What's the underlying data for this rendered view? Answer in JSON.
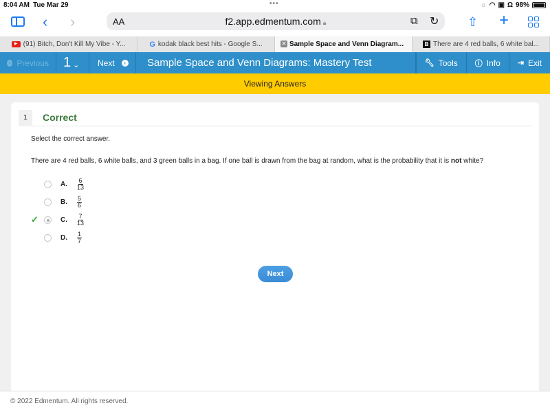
{
  "status_bar": {
    "time": "8:04 AM",
    "date": "Tue Mar 29",
    "battery": "98%",
    "battery_level": 0.98
  },
  "browser": {
    "text_size_label": "AA",
    "url": "f2.app.edmentum.com",
    "tabs": [
      {
        "favicon": "youtube-icon",
        "title": "(91) Bitch, Don't Kill My Vibe - Y...",
        "active": false
      },
      {
        "favicon": "google-icon",
        "title": "kodak black best hits - Google S...",
        "active": false
      },
      {
        "favicon": "edmentum-icon",
        "title": "Sample Space and Venn Diagram...",
        "active": true
      },
      {
        "favicon": "brainly-icon",
        "title": "There are 4 red balls, 6 white bal...",
        "active": false
      }
    ]
  },
  "nav": {
    "previous_label": "Previous",
    "question_number": "1",
    "next_label": "Next",
    "title": "Sample Space and Venn Diagrams: Mastery Test",
    "tools_label": "Tools",
    "info_label": "Info",
    "exit_label": "Exit",
    "accent_color": "#2e8fca"
  },
  "banner": {
    "text": "Viewing Answers",
    "color": "#ffcc00"
  },
  "question": {
    "number": "1",
    "status": "Correct",
    "instruction": "Select the correct answer.",
    "text_before": "There are 4 red balls, 6 white balls, and 3 green balls in a bag. If one ball is drawn from the bag at random, what is the probability that it is ",
    "text_bold": "not",
    "text_after": " white?",
    "choices": [
      {
        "letter": "A.",
        "numerator": "6",
        "denominator": "13",
        "selected": false,
        "correct": false
      },
      {
        "letter": "B.",
        "numerator": "5",
        "denominator": "6",
        "selected": false,
        "correct": false
      },
      {
        "letter": "C.",
        "numerator": "7",
        "denominator": "13",
        "selected": true,
        "correct": true
      },
      {
        "letter": "D.",
        "numerator": "1",
        "denominator": "7",
        "selected": false,
        "correct": false
      }
    ],
    "next_button": "Next"
  },
  "footer": {
    "copyright": "© 2022 Edmentum. All rights reserved."
  }
}
